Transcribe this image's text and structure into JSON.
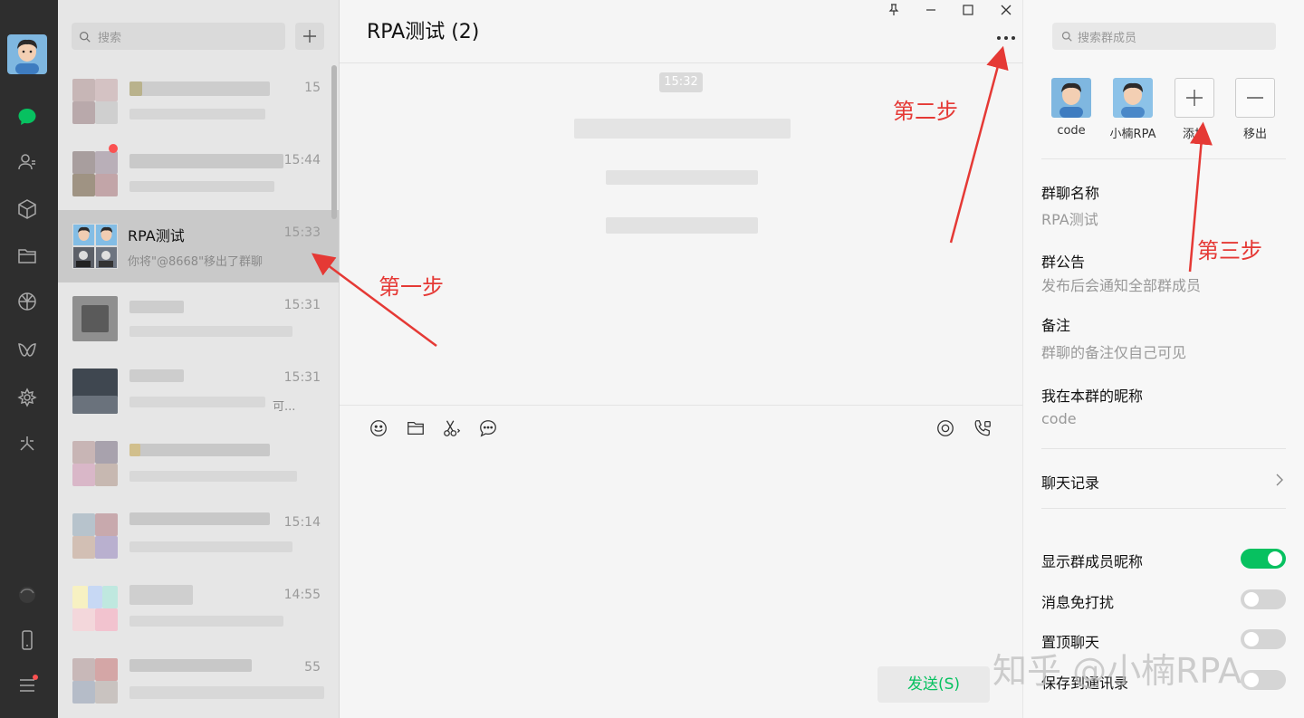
{
  "sidebar": {
    "icons": [
      "chat-icon",
      "contacts-icon",
      "box-icon",
      "folder-icon",
      "moments-icon",
      "channels-icon",
      "search-network-icon",
      "mini-program-icon",
      "mobile-icon",
      "menu-icon"
    ],
    "active_color": "#07c160"
  },
  "list": {
    "search_placeholder": "搜索",
    "conversations": [
      {
        "name": "",
        "time": "15",
        "preview": ""
      },
      {
        "name": "",
        "time": "15:44",
        "preview": "..."
      },
      {
        "name": "RPA测试",
        "time": "15:33",
        "preview": "你将\"@8668\"移出了群聊"
      },
      {
        "name": "",
        "time": "15:31",
        "preview": ""
      },
      {
        "name": "",
        "time": "15:31",
        "preview": "可..."
      },
      {
        "name": "",
        "time": "",
        "preview": ""
      },
      {
        "name": "",
        "time": "15:14",
        "preview": ""
      },
      {
        "name": "",
        "time": "14:55",
        "preview": ""
      },
      {
        "name": "",
        "time": "55",
        "preview": ""
      }
    ]
  },
  "chat": {
    "title": "RPA测试 (2)",
    "timestamp": "15:32",
    "send_label": "发送(S)"
  },
  "panel": {
    "search_placeholder": "搜索群成员",
    "members": [
      {
        "label": "code"
      },
      {
        "label": "小楠RPA"
      },
      {
        "label": "添加"
      },
      {
        "label": "移出"
      }
    ],
    "group_name_label": "群聊名称",
    "group_name_value": "RPA测试",
    "notice_label": "群公告",
    "notice_value": "发布后会通知全部群成员",
    "remark_label": "备注",
    "remark_value": "群聊的备注仅自己可见",
    "nickname_label": "我在本群的昵称",
    "nickname_value": "code",
    "history_label": "聊天记录",
    "toggles": [
      {
        "label": "显示群成员昵称",
        "on": true
      },
      {
        "label": "消息免打扰",
        "on": false
      },
      {
        "label": "置顶聊天",
        "on": false
      },
      {
        "label": "保存到通讯录",
        "on": false
      }
    ]
  },
  "annotations": {
    "step1": "第一步",
    "step2": "第二步",
    "step3": "第三步",
    "color": "#e53935"
  },
  "watermark": "知乎 @小楠RPA"
}
